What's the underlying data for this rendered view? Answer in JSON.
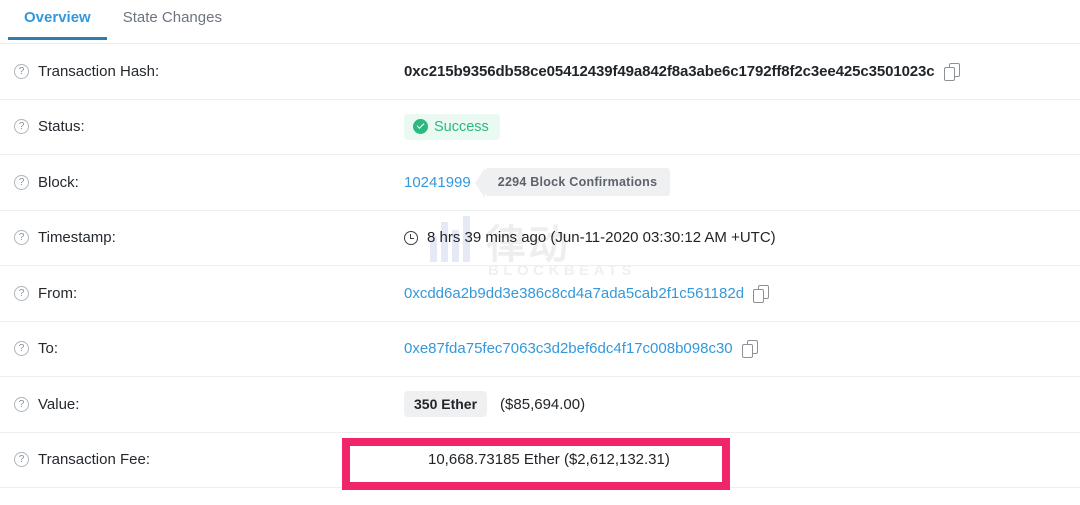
{
  "watermark": {
    "cn_text": "律动",
    "en_text": "BLOCKBEATS",
    "logo_icon": "bar-chart-logo-icon"
  },
  "tabs": [
    {
      "label": "Overview",
      "active": true
    },
    {
      "label": "State Changes",
      "active": false
    }
  ],
  "icons": {
    "help": "?",
    "copy": "copy-icon",
    "clock": "clock-icon",
    "check": "check-circle-icon"
  },
  "colors": {
    "accent_blue": "#3498db",
    "tab_underline": "#2f7cb5",
    "success_green": "#2cb87f",
    "success_bg": "#eaf9f2",
    "badge_gray": "#eef0f2",
    "highlight_pink": "#f0256a",
    "text_dark": "#212529",
    "border": "#eceef0"
  },
  "rows": {
    "transaction_hash": {
      "label": "Transaction Hash:",
      "value": "0xc215b9356db58ce05412439f49a842f8a3abe6c1792ff8f2c3ee425c3501023c"
    },
    "status": {
      "label": "Status:",
      "value": "Success"
    },
    "block": {
      "label": "Block:",
      "number": "10241999",
      "confirmations": "2294 Block Confirmations"
    },
    "timestamp": {
      "label": "Timestamp:",
      "value": "8 hrs 39 mins ago (Jun-11-2020 03:30:12 AM +UTC)"
    },
    "from": {
      "label": "From:",
      "value": "0xcdd6a2b9dd3e386c8cd4a7ada5cab2f1c561182d"
    },
    "to": {
      "label": "To:",
      "value": "0xe87fda75fec7063c3d2bef6dc4f17c008b098c30"
    },
    "value": {
      "label": "Value:",
      "ether": "350 Ether",
      "usd": "($85,694.00)"
    },
    "transaction_fee": {
      "label": "Transaction Fee:",
      "value": "10,668.73185 Ether ($2,612,132.31)",
      "highlighted": true
    }
  }
}
